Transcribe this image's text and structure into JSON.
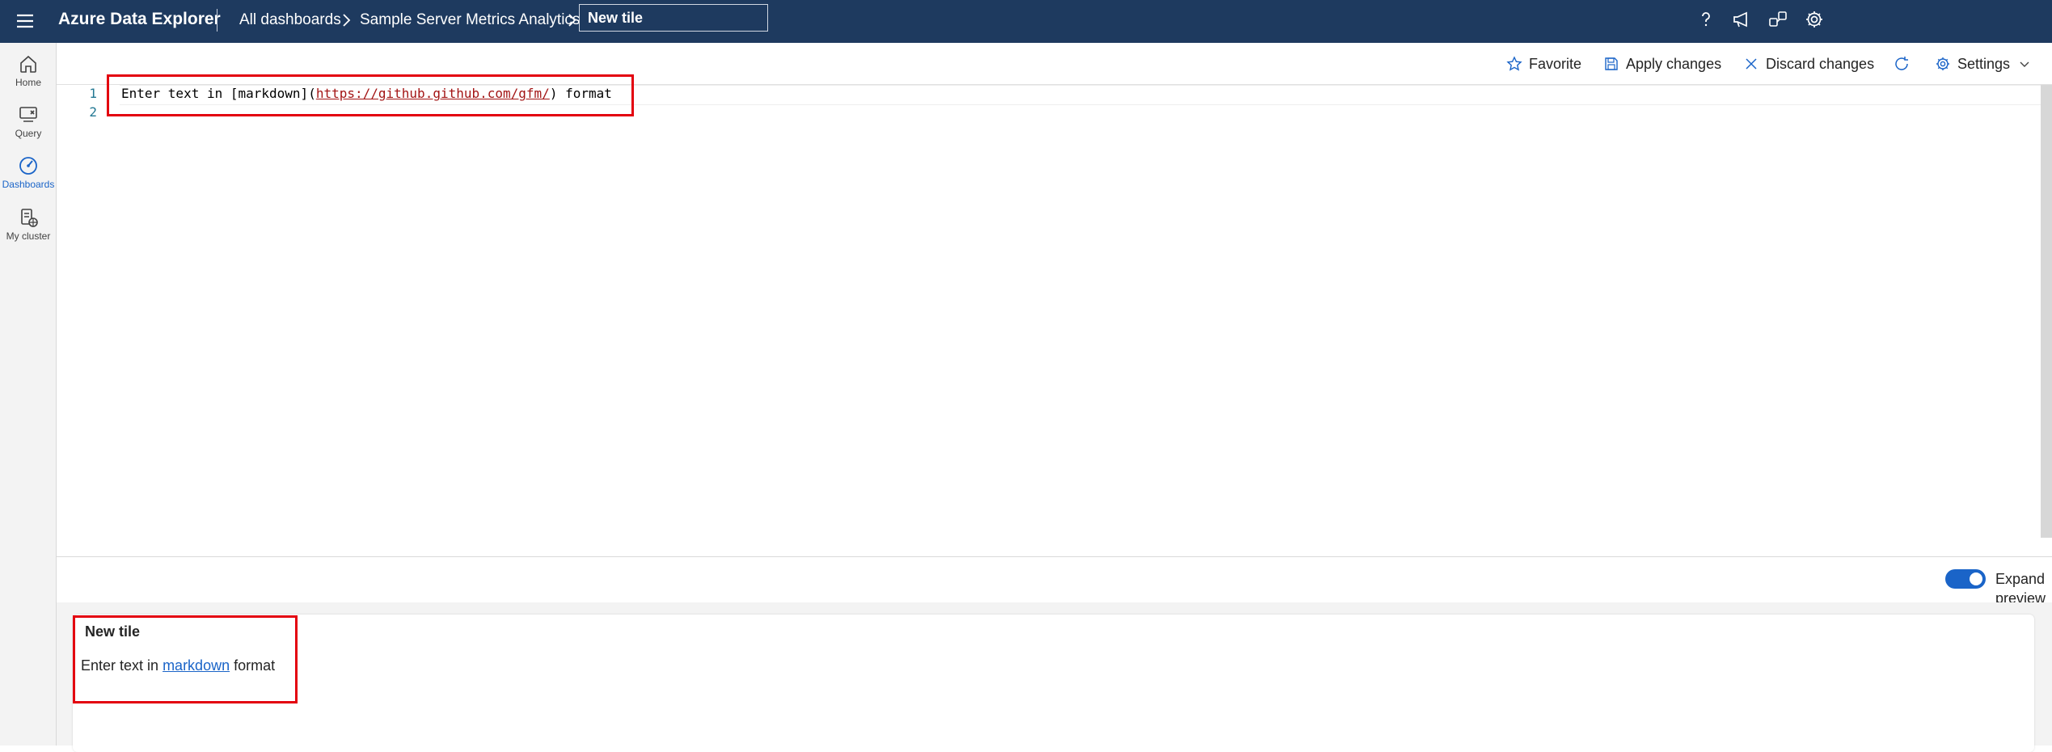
{
  "topbar": {
    "app_title": "Azure Data Explorer",
    "breadcrumbs": [
      "All dashboards",
      "Sample Server Metrics Analytics"
    ],
    "tile_name_value": "New tile",
    "icons": [
      "help-icon",
      "feedback-icon",
      "share-icon",
      "gear-icon"
    ]
  },
  "leftrail": {
    "items": [
      {
        "label": "Home",
        "icon": "home-icon"
      },
      {
        "label": "Query",
        "icon": "query-icon"
      },
      {
        "label": "Dashboards",
        "icon": "dashboard-gauge-icon",
        "active": true
      },
      {
        "label": "My cluster",
        "icon": "cluster-icon"
      }
    ]
  },
  "commandbar": {
    "favorite": "Favorite",
    "apply": "Apply changes",
    "discard": "Discard changes",
    "settings": "Settings"
  },
  "editor": {
    "line_numbers": [
      "1",
      "2"
    ],
    "line1_prefix": "Enter text in [markdown](",
    "line1_link": "https://github.github.com/gfm/",
    "line1_suffix": ") format"
  },
  "preview": {
    "toggle_label": "Expand preview",
    "toggle_on": true,
    "tile_title": "New tile",
    "body_prefix": "Enter text in ",
    "body_link": "markdown",
    "body_suffix": " format"
  },
  "colors": {
    "topbar_bg": "#1e3a5f",
    "accent": "#1a64c8",
    "highlight_red": "#e3000f"
  }
}
